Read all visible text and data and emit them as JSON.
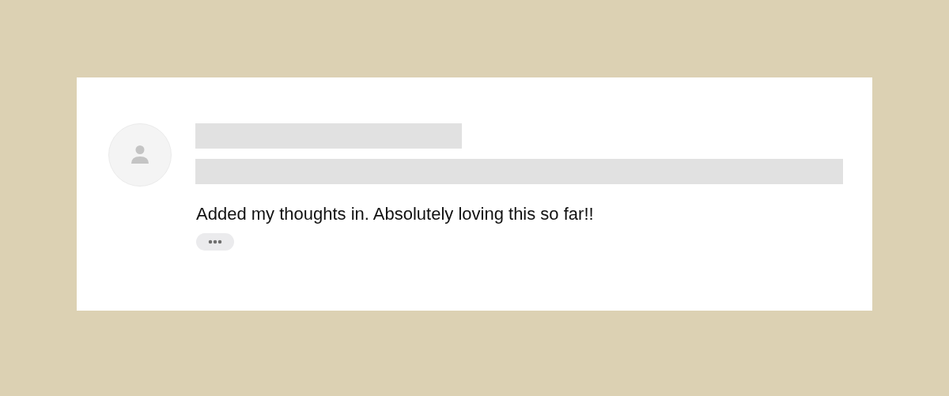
{
  "comment": {
    "text": "Added my thoughts in. Absolutely loving this so far!!"
  }
}
